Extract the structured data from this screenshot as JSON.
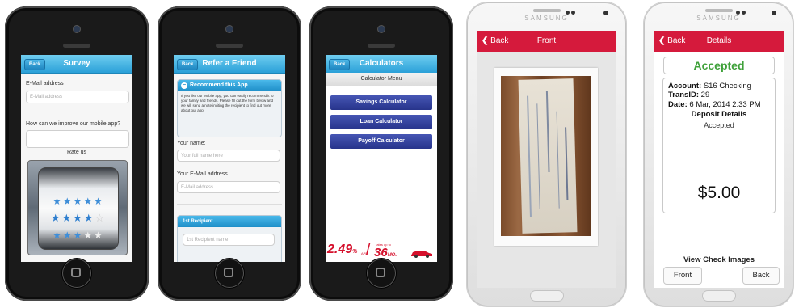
{
  "phone1": {
    "nav": {
      "back": "Back",
      "title": "Survey"
    },
    "email_label": "E-Mail address",
    "email_placeholder": "E-Mail address",
    "improve_label": "How can we improve our mobile app?",
    "rate_label": "Rate us",
    "rating_rows": [
      {
        "stars": 5,
        "filled": 5
      },
      {
        "stars": 5,
        "filled": 4
      },
      {
        "stars": 5,
        "filled": 3
      }
    ]
  },
  "phone2": {
    "nav": {
      "back": "Back",
      "title": "Refer a Friend"
    },
    "panel_title": "Recommend this App",
    "panel_text": "If you like our Mobile app, you can easily recommend it to your family and friends. Please fill out the form below and we will send a note inviting the recipient to find out more about our app.",
    "name_label": "Your name:",
    "name_placeholder": "Your full name here",
    "email_label": "Your E-Mail address",
    "email_placeholder": "E-Mail address",
    "recipient_title": "1st Recipient",
    "recipient_placeholder": "1st Recipient name"
  },
  "phone3": {
    "nav": {
      "back": "Back",
      "title": "Calculators"
    },
    "menu_title": "Calculator Menu",
    "buttons": [
      "Savings Calculator",
      "Loan Calculator",
      "Payoff Calculator"
    ],
    "ad": {
      "rate": "2.49",
      "rate_suffix": "%",
      "rate_sub": "APR",
      "small_text": "rates up to",
      "term": "36",
      "term_suffix": "MO."
    }
  },
  "phone4": {
    "brand": "SAMSUNG",
    "nav": {
      "back": "Back",
      "title": "Front"
    }
  },
  "phone5": {
    "brand": "SAMSUNG",
    "nav": {
      "back": "Back",
      "title": "Details"
    },
    "status": "Accepted",
    "account_label": "Account:",
    "account_value": "S16 Checking",
    "trans_label": "TransID:",
    "trans_value": "29",
    "date_label": "Date:",
    "date_value": "6 Mar, 2014 2:33 PM",
    "deposit_title": "Deposit Details",
    "deposit_status": "Accepted",
    "amount": "$5.00",
    "view_images": "View Check Images",
    "front_button": "Front",
    "back_button": "Back"
  },
  "colors": {
    "ios_nav": "#2aa0d8",
    "calc_button": "#2b3a8f",
    "android_bar": "#d51a3c",
    "accepted_green": "#3fa13a",
    "ad_red": "#d5102c"
  }
}
